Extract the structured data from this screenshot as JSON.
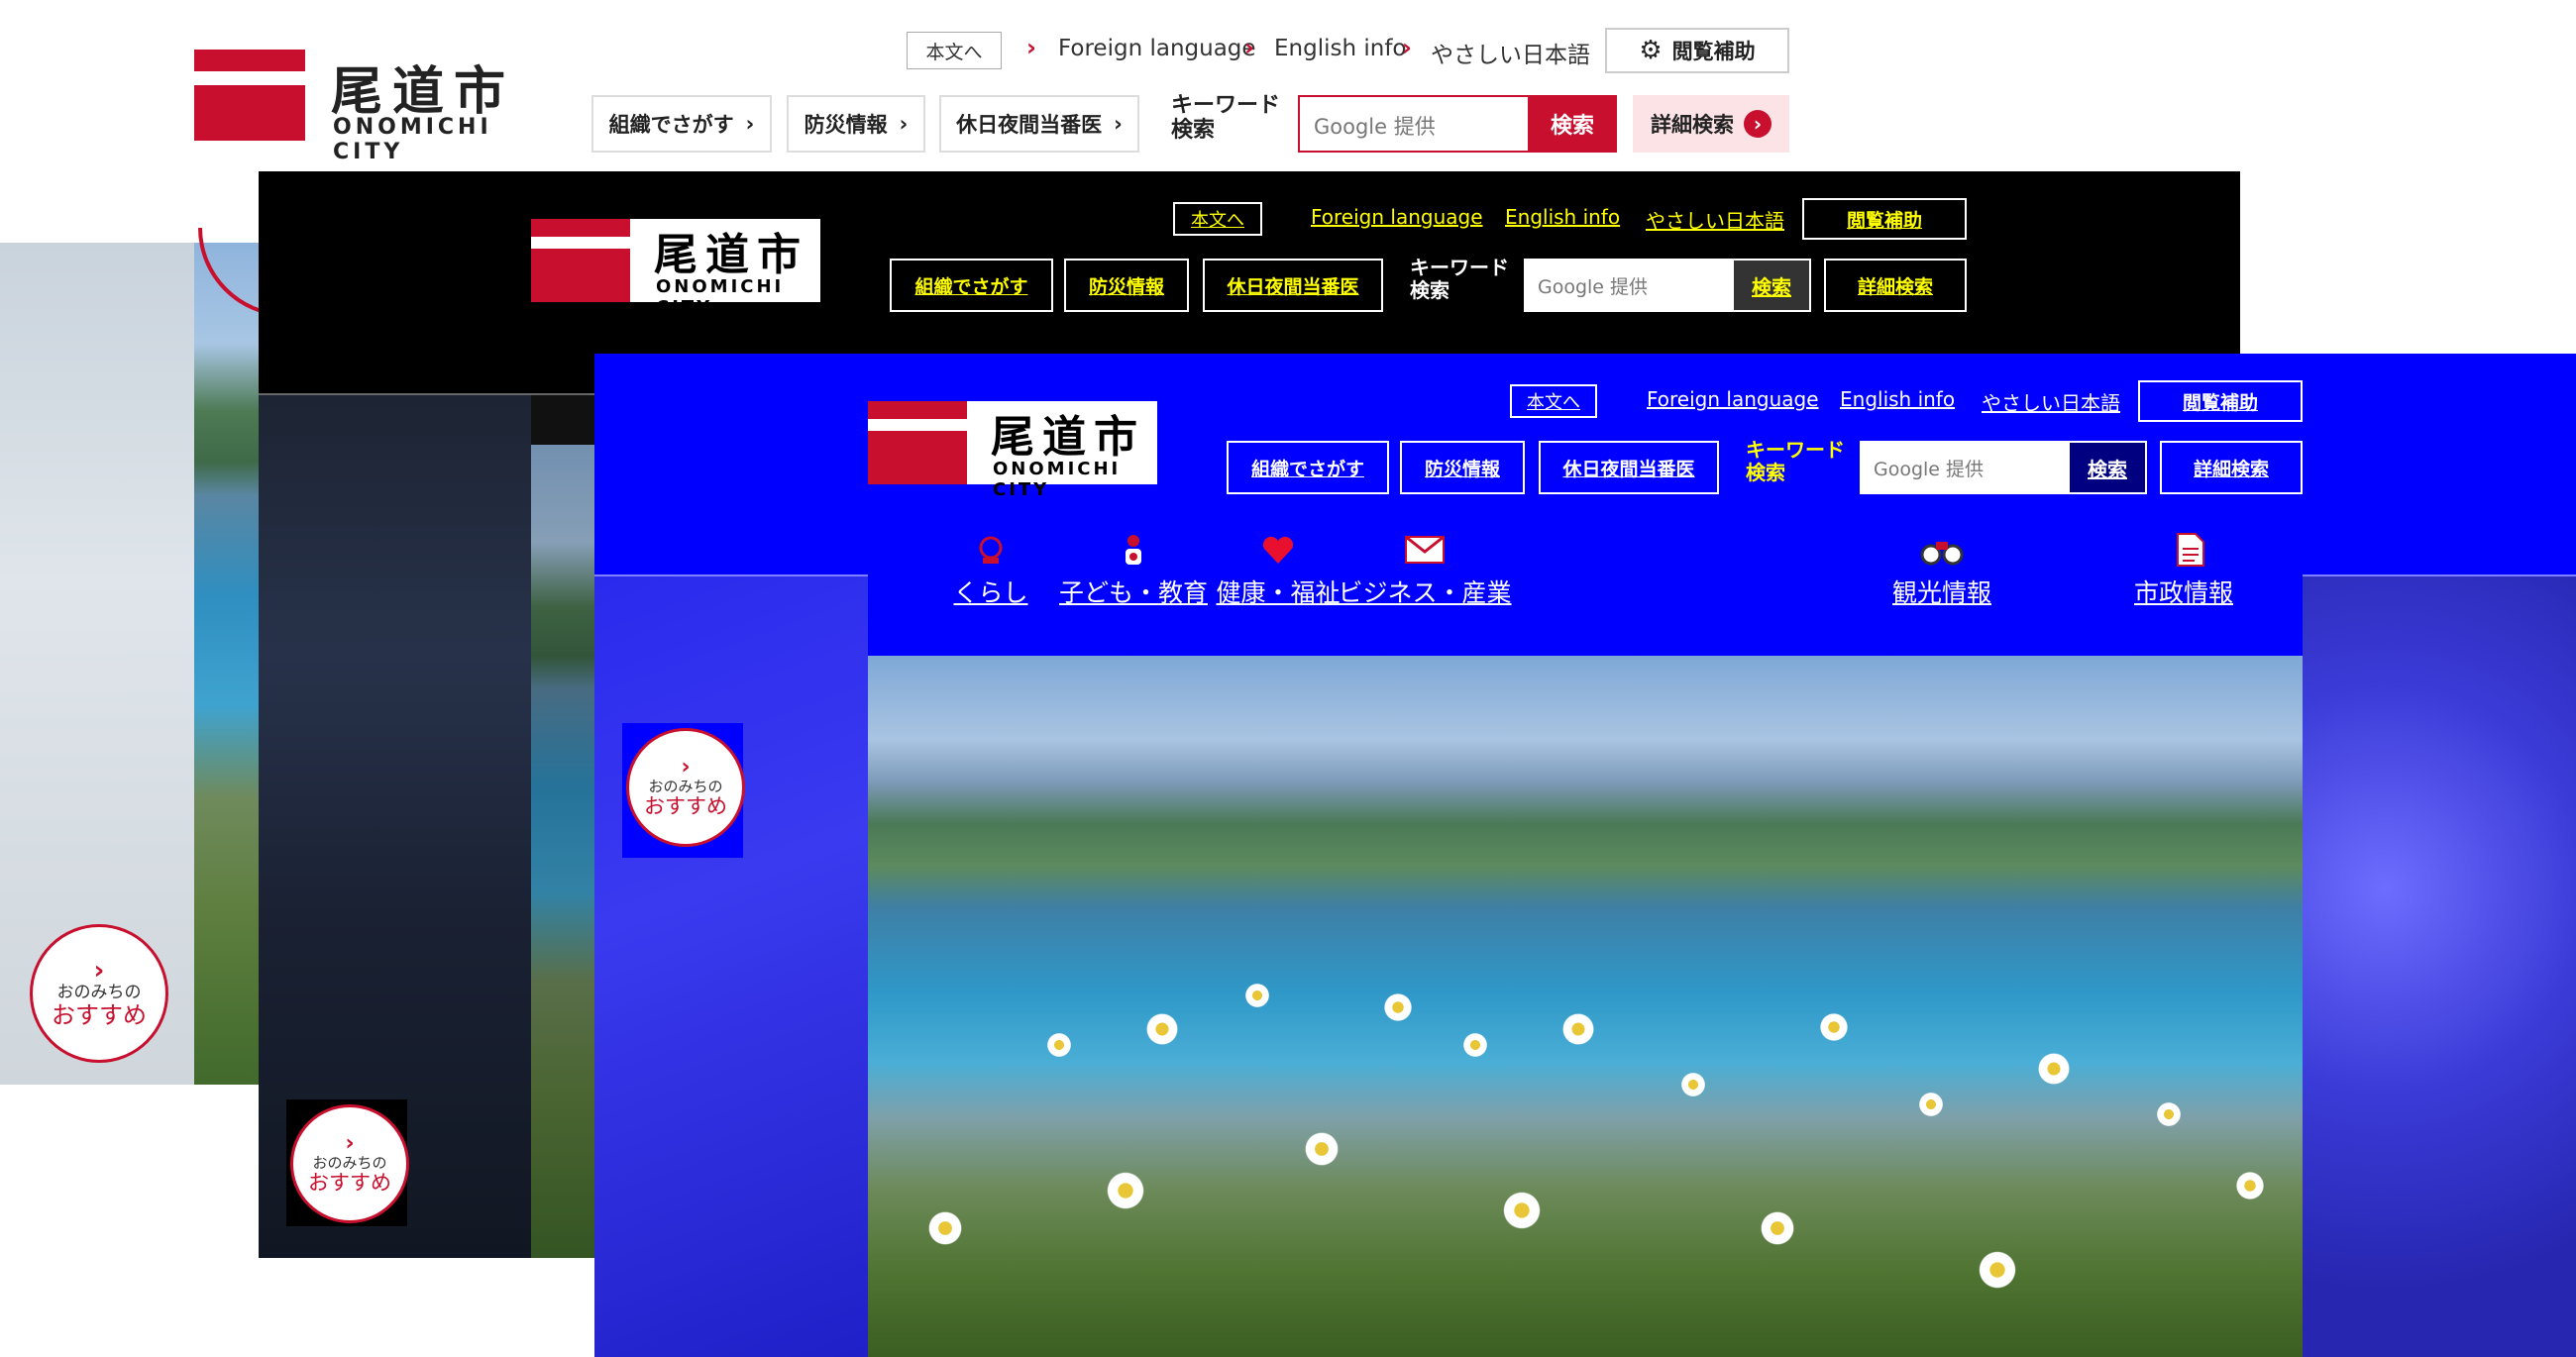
{
  "logo": {
    "kanji": "尾道市",
    "roman": "ONOMICHI CITY"
  },
  "header": {
    "skip_label": "本文へ",
    "lang_links": [
      "Foreign language",
      "English info",
      "やさしい日本語"
    ],
    "assist_label": "閲覧補助",
    "quick_buttons": [
      "組織でさがす",
      "防災情報",
      "休日夜間当番医"
    ],
    "keyword_label": "キーワード 検索",
    "search_placeholder": "Google 提供",
    "search_button": "検索",
    "advanced_search": "詳細検索"
  },
  "nav": [
    "くらし",
    "子ども・教育",
    "健康・福祉",
    "ビジネス・産業",
    "観光情報",
    "市政情報"
  ],
  "recommend": {
    "small": "おのみちの",
    "big": "おすすめ",
    "chevron": "›"
  },
  "icons": {
    "gear": "gear-icon",
    "chevron": "chevron-right-icon",
    "arrow_circle": "arrow-circle-icon",
    "nav_icons": [
      "life-icon",
      "child-icon",
      "heart-icon",
      "mail-icon",
      "binoculars-icon",
      "document-icon"
    ]
  },
  "theme_colors": {
    "brand_red": "#c8102e",
    "black_theme": "#000000",
    "blue_theme": "#0000ff",
    "link_yellow": "#ffff00"
  }
}
